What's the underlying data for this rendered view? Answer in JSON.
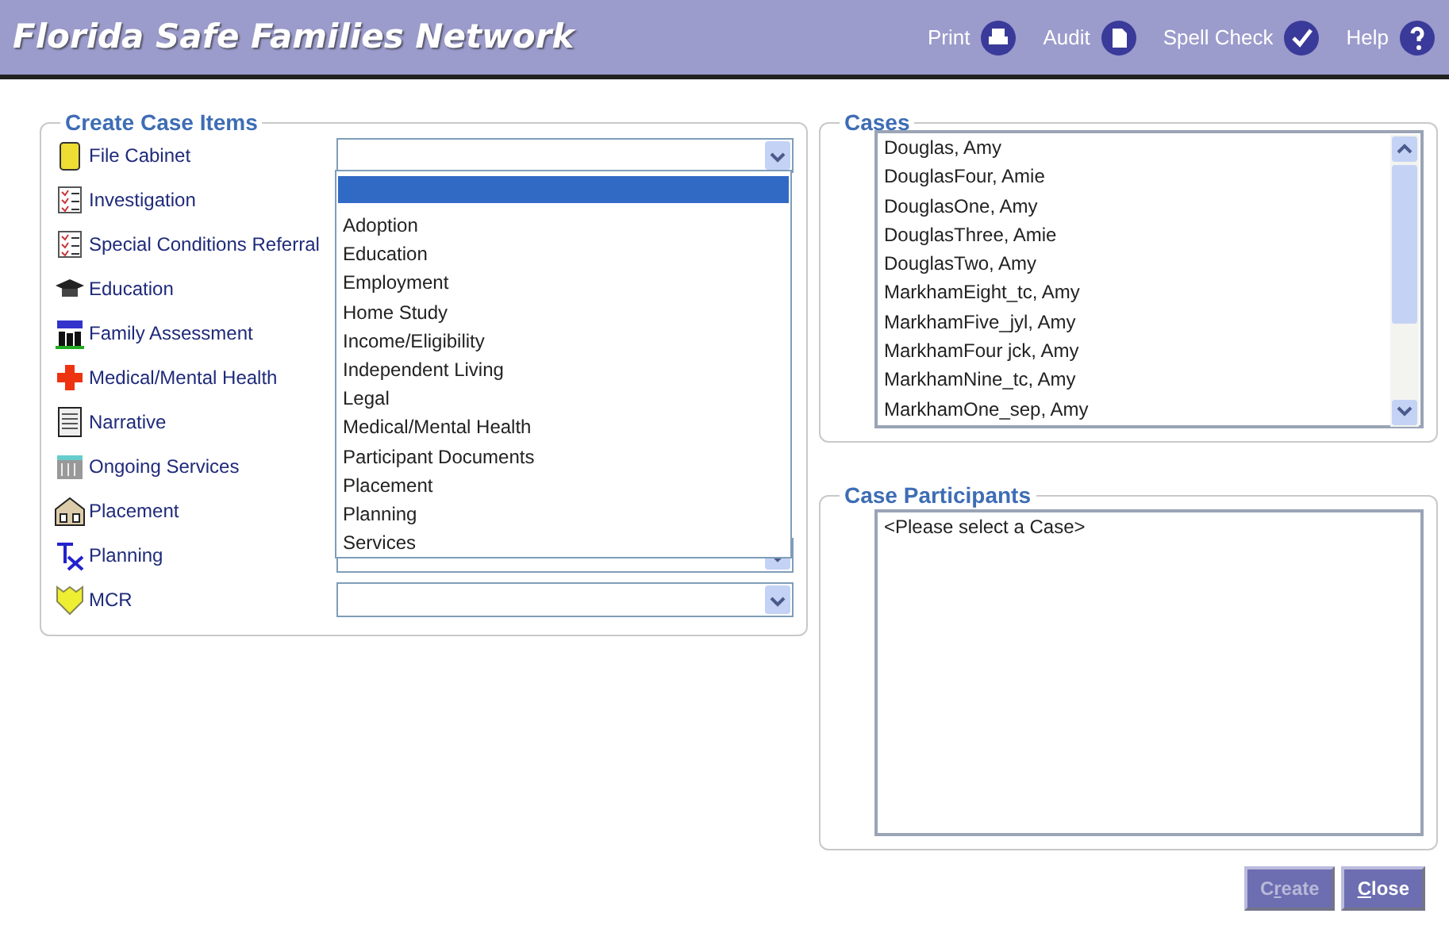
{
  "header": {
    "title": "Florida Safe Families Network",
    "actions": [
      {
        "label": "Print",
        "kind": "print"
      },
      {
        "label": "Audit",
        "kind": "audit"
      },
      {
        "label": "Spell Check",
        "kind": "spell"
      },
      {
        "label": "Help",
        "kind": "help"
      }
    ]
  },
  "create_case_items": {
    "legend": "Create Case Items",
    "items": [
      {
        "label": "File Cabinet",
        "dropdown": true
      },
      {
        "label": "Investigation"
      },
      {
        "label": "Special Conditions Referral"
      },
      {
        "label": "Education"
      },
      {
        "label": "Family Assessment"
      },
      {
        "label": "Medical/Mental Health"
      },
      {
        "label": "Narrative"
      },
      {
        "label": "Ongoing Services"
      },
      {
        "label": "Placement"
      },
      {
        "label": "Planning",
        "dropdown": true
      },
      {
        "label": "MCR",
        "dropdown": true
      }
    ],
    "open_list": {
      "highlight_blank_row": true,
      "options": [
        "Adoption",
        "Education",
        "Employment",
        "Home Study",
        "Income/Eligibility",
        "Independent Living",
        "Legal",
        "Medical/Mental Health",
        "Participant Documents",
        "Placement",
        "Planning",
        "Services"
      ]
    }
  },
  "cases": {
    "legend": "Cases",
    "items": [
      "Douglas, Amy",
      "DouglasFour, Amie",
      "DouglasOne, Amy",
      "DouglasThree, Amie",
      "DouglasTwo, Amy",
      "MarkhamEight_tc, Amy",
      "MarkhamFive_jyl, Amy",
      "MarkhamFour jck, Amy",
      "MarkhamNine_tc, Amy",
      "MarkhamOne_sep, Amy"
    ]
  },
  "case_participants": {
    "legend": "Case Participants",
    "items": [
      "<Please select a Case>"
    ]
  },
  "buttons": [
    {
      "before": "C",
      "accel": "r",
      "after": "eate",
      "disabled": true
    },
    {
      "accel": "C",
      "after": "lose",
      "disabled": false
    }
  ]
}
